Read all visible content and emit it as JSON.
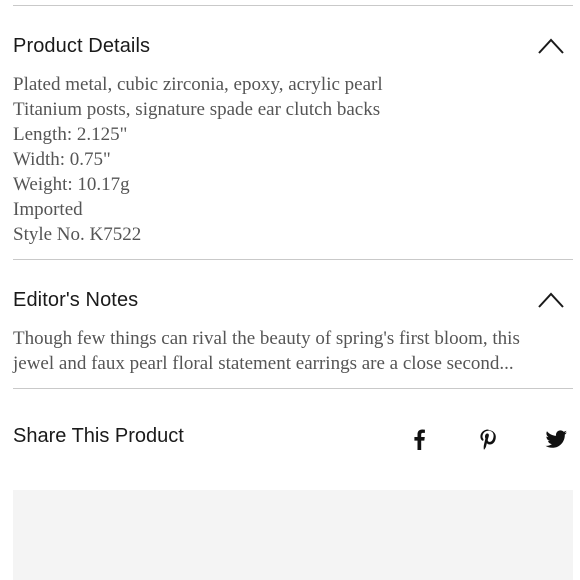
{
  "product_details": {
    "title": "Product Details",
    "lines": [
      "Plated metal, cubic zirconia, epoxy, acrylic pearl",
      "Titanium posts, signature spade ear clutch backs",
      "Length: 2.125\"",
      "Width: 0.75\"",
      "Weight: 10.17g",
      "Imported",
      "Style No. K7522"
    ],
    "icon": "chevron-up-icon"
  },
  "editors_notes": {
    "title": "Editor's Notes",
    "lines": [
      "Though few things can rival the beauty of spring's first bloom, this",
      "jewel and faux pearl floral statement earrings are a close second..."
    ],
    "icon": "chevron-up-icon"
  },
  "share": {
    "title": "Share This Product",
    "icons": [
      "facebook-icon",
      "pinterest-icon",
      "twitter-icon"
    ]
  },
  "colors": {
    "text": "#1a1a1a",
    "body_text": "#555555",
    "divider": "#c9c9c9",
    "panel": "#f4f4f4"
  }
}
